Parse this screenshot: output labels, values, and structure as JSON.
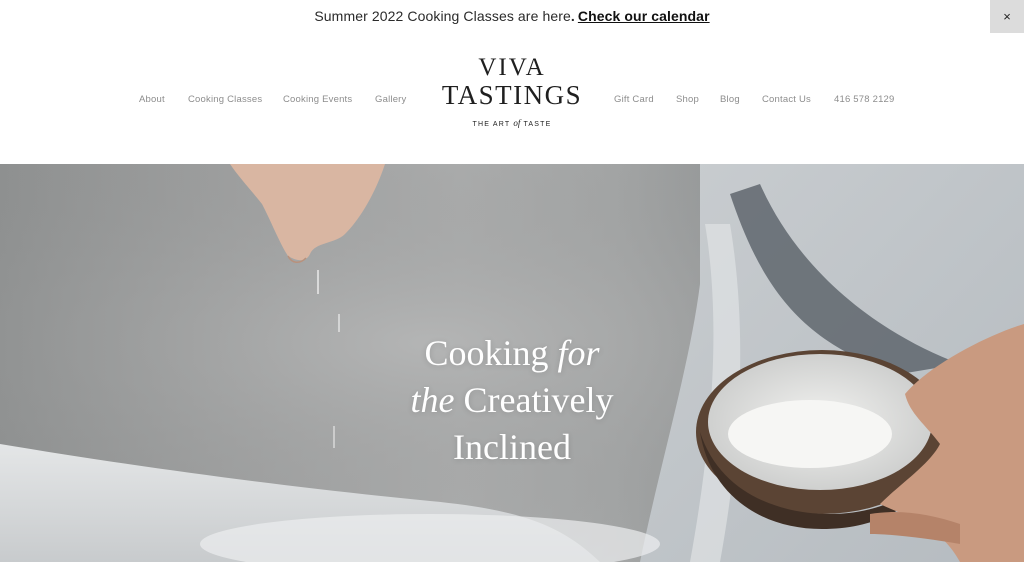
{
  "announcement": {
    "text": "Summer 2022 Cooking Classes are here",
    "period": ".",
    "link": "Check our calendar",
    "close": "×"
  },
  "nav": {
    "left": [
      "About",
      "Cooking Classes",
      "Cooking Events",
      "Gallery"
    ],
    "right": [
      "Gift Card",
      "Shop",
      "Blog",
      "Contact Us",
      "416 578 2129"
    ]
  },
  "logo": {
    "line1": "VIVA",
    "line2": "TASTINGS",
    "tag_pre": "THE ART",
    "tag_of": "of",
    "tag_post": "TASTE"
  },
  "hero": {
    "line1_a": "Cooking ",
    "line1_b": "for",
    "line2_a": "the",
    "line2_b": " Creatively",
    "line3": "Inclined"
  }
}
